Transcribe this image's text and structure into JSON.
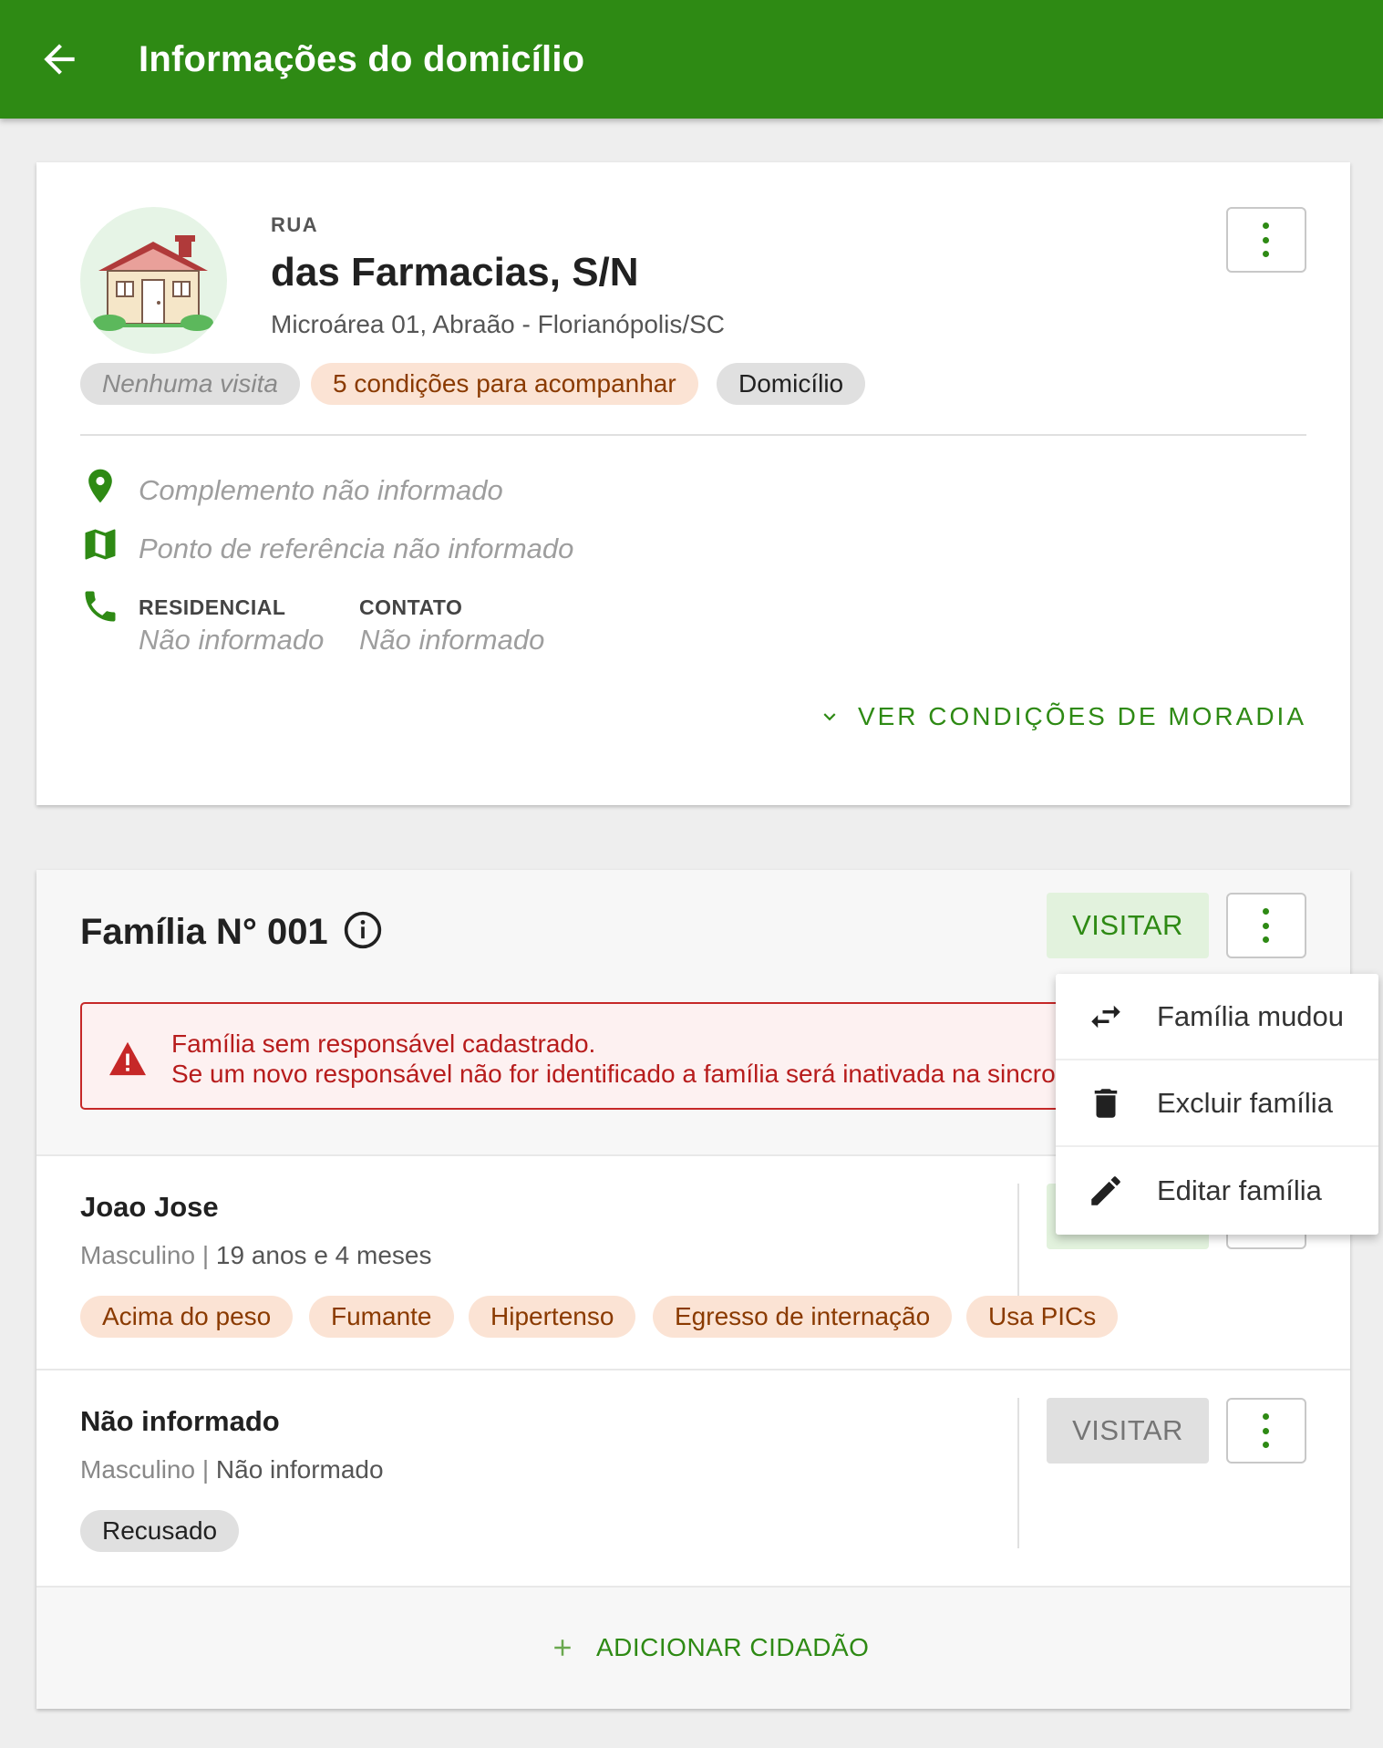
{
  "appbar": {
    "title": "Informações do domicílio",
    "back_icon": "arrow-left-icon"
  },
  "address": {
    "type": "RUA",
    "name": "das Farmacias, S/N",
    "subtitle": "Microárea 01, Abraão - Florianópolis/SC",
    "chips": [
      "Nenhuma visita",
      "5 condições para acompanhar",
      "Domicílio"
    ],
    "complemento": "Complemento não informado",
    "referencia": "Ponto de referência não informado",
    "phones": [
      {
        "label": "RESIDENCIAL",
        "value": "Não informado"
      },
      {
        "label": "CONTATO",
        "value": "Não informado"
      }
    ],
    "conditions_link": "VER CONDIÇÕES DE MORADIA"
  },
  "family": {
    "title": "Família N° 001",
    "visit_label": "VISITAR",
    "alert": {
      "line1": "Família sem responsável cadastrado.",
      "line2": "Se um novo responsável não for identificado a família será inativada na sincro"
    },
    "members": [
      {
        "name": "Joao Jose",
        "sex": "Masculino",
        "sep": " | ",
        "age": "19 anos e 4 meses",
        "chips": [
          "Acima do peso",
          "Fumante",
          "Hipertenso",
          "Egresso de internação",
          "Usa PICs"
        ]
      },
      {
        "name": "Não informado",
        "sex": "Masculino",
        "sep": " | ",
        "age": "Não informado",
        "chips": [
          "Recusado"
        ],
        "visit_label": "VISITAR"
      }
    ],
    "add_label": "ADICIONAR CIDADÃO"
  },
  "menu": {
    "items": [
      {
        "label": "Família mudou",
        "icon": "swap-arrows-icon"
      },
      {
        "label": "Excluir família",
        "icon": "trash-icon"
      },
      {
        "label": "Editar família",
        "icon": "pencil-icon"
      }
    ]
  },
  "colors": {
    "primary": "#2e8a14",
    "danger": "#c62828",
    "chip_orange_bg": "#fbe3d4",
    "chip_orange_text": "#8a3a00"
  }
}
